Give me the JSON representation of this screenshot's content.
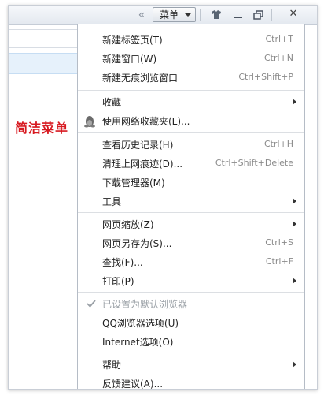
{
  "toolbar": {
    "menu_label": "菜单",
    "collapse_glyph": "«",
    "close_glyph": "✕",
    "icons": [
      "skin-icon",
      "minimize-icon",
      "restore-icon",
      "close-icon"
    ]
  },
  "caption": "简洁菜单",
  "menu": {
    "items": [
      {
        "label": "新建标签页(T)",
        "shortcut": "Ctrl+T"
      },
      {
        "label": "新建窗口(W)",
        "shortcut": "Ctrl+N"
      },
      {
        "label": "新建无痕浏览窗口",
        "shortcut": "Ctrl+Shift+P"
      },
      {
        "label": "收藏",
        "submenu": true
      },
      {
        "label": "使用网络收藏夹(L)...",
        "icon": "penguin-icon"
      },
      {
        "label": "查看历史记录(H)",
        "shortcut": "Ctrl+H"
      },
      {
        "label": "清理上网痕迹(D)...",
        "shortcut": "Ctrl+Shift+Delete"
      },
      {
        "label": "下载管理器(M)"
      },
      {
        "label": "工具",
        "submenu": true
      },
      {
        "label": "网页缩放(Z)",
        "submenu": true
      },
      {
        "label": "网页另存为(S)...",
        "shortcut": "Ctrl+S"
      },
      {
        "label": "查找(F)...",
        "shortcut": "Ctrl+F"
      },
      {
        "label": "打印(P)",
        "submenu": true
      },
      {
        "label": "已设置为默认浏览器",
        "disabled": true,
        "checked": true
      },
      {
        "label": "QQ浏览器选项(U)"
      },
      {
        "label": "Internet选项(O)"
      },
      {
        "label": "帮助",
        "submenu": true
      },
      {
        "label": "反馈建议(A)..."
      }
    ]
  },
  "colors": {
    "caption": "#d71920",
    "selection": "#e6f1fb"
  }
}
